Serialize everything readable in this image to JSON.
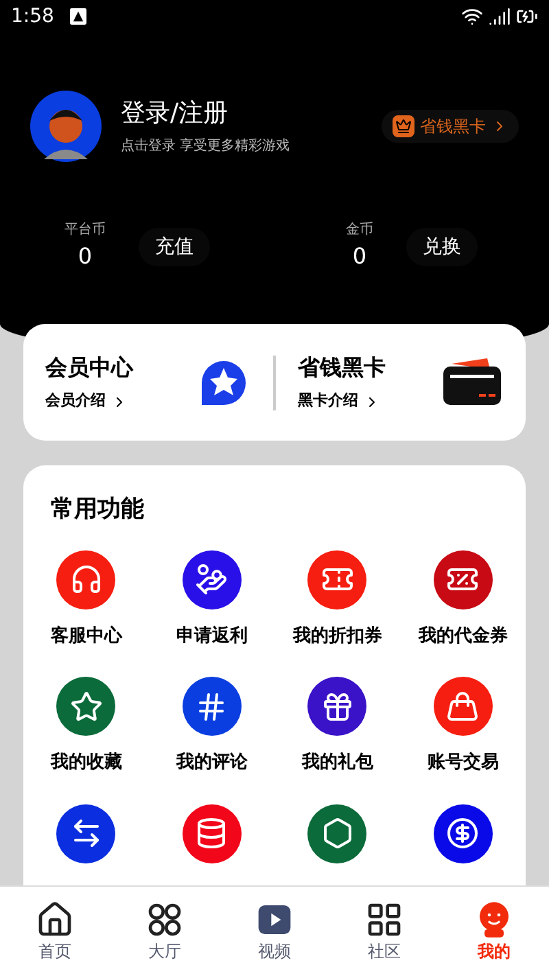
{
  "status_bar": {
    "time": "1:58"
  },
  "profile": {
    "title": "登录/注册",
    "subtitle": "点击登录 享受更多精彩游戏",
    "badge": "省钱黑卡"
  },
  "balances": [
    {
      "label": "平台币",
      "value": "0",
      "action": "充值"
    },
    {
      "label": "金币",
      "value": "0",
      "action": "兑换"
    }
  ],
  "member_cards": [
    {
      "title": "会员中心",
      "link": "会员介绍"
    },
    {
      "title": "省钱黑卡",
      "link": "黑卡介绍"
    }
  ],
  "functions": {
    "title": "常用功能",
    "items": [
      {
        "label": "客服中心",
        "color": "#f61e10"
      },
      {
        "label": "申请返利",
        "color": "#2a10e8"
      },
      {
        "label": "我的折扣券",
        "color": "#f61e10"
      },
      {
        "label": "我的代金券",
        "color": "#c80a14"
      },
      {
        "label": "我的收藏",
        "color": "#0b6b3a"
      },
      {
        "label": "我的评论",
        "color": "#0a3ee0"
      },
      {
        "label": "我的礼包",
        "color": "#3a12c8"
      },
      {
        "label": "账号交易",
        "color": "#f61e10"
      },
      {
        "color": "#0a2ee0"
      },
      {
        "color": "#f2061a"
      },
      {
        "color": "#0b6b3a"
      },
      {
        "color": "#0a0ae8"
      }
    ]
  },
  "nav": [
    {
      "label": "首页",
      "selected": false
    },
    {
      "label": "大厅",
      "selected": false
    },
    {
      "label": "视频",
      "selected": false
    },
    {
      "label": "社区",
      "selected": false
    },
    {
      "label": "我的",
      "selected": true
    }
  ]
}
